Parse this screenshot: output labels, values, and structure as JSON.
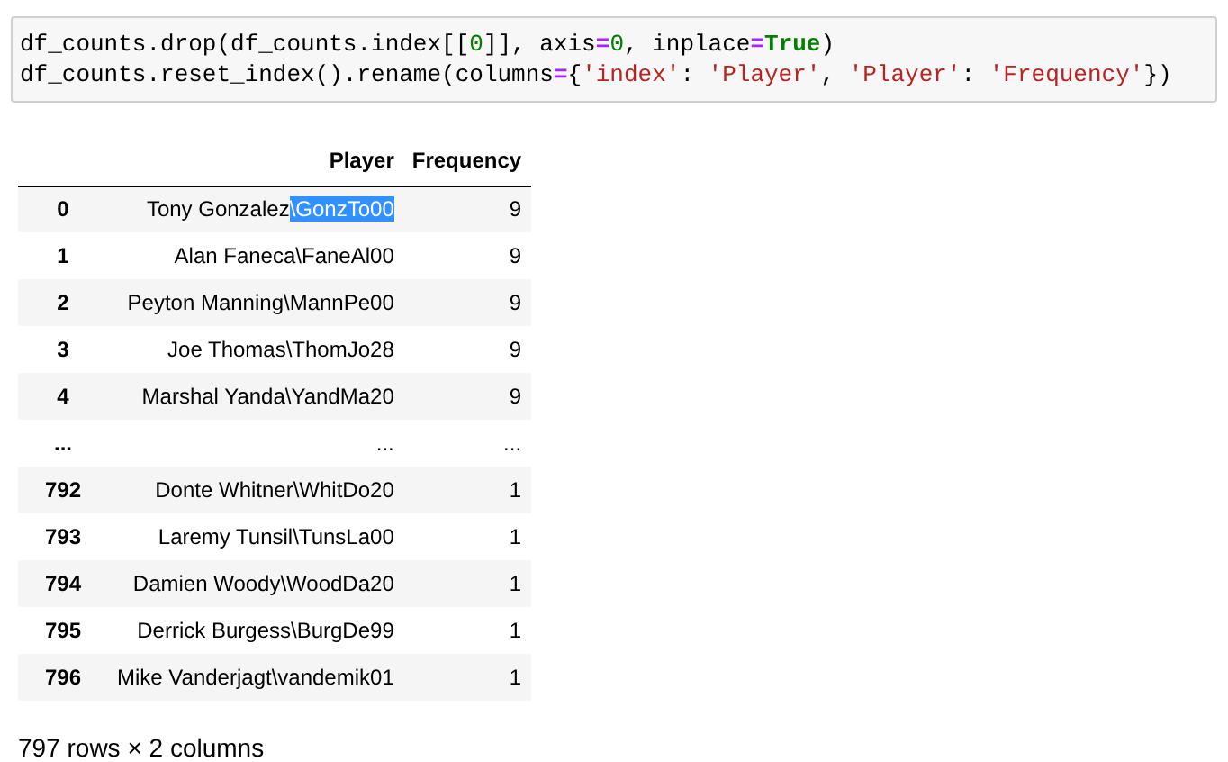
{
  "code_cell": {
    "lines": [
      {
        "tokens": [
          {
            "text": "df_counts.drop(df_counts.index[[",
            "kind": "plain"
          },
          {
            "text": "0",
            "kind": "number"
          },
          {
            "text": "]], axis",
            "kind": "plain"
          },
          {
            "text": "=",
            "kind": "operator"
          },
          {
            "text": "0",
            "kind": "number"
          },
          {
            "text": ", inplace",
            "kind": "plain"
          },
          {
            "text": "=",
            "kind": "operator"
          },
          {
            "text": "True",
            "kind": "keyword"
          },
          {
            "text": ")",
            "kind": "plain"
          }
        ]
      },
      {
        "tokens": [
          {
            "text": "df_counts.reset_index().rename(columns",
            "kind": "plain"
          },
          {
            "text": "=",
            "kind": "operator"
          },
          {
            "text": "{",
            "kind": "plain"
          },
          {
            "text": "'index'",
            "kind": "string"
          },
          {
            "text": ": ",
            "kind": "plain"
          },
          {
            "text": "'Player'",
            "kind": "string"
          },
          {
            "text": ", ",
            "kind": "plain"
          },
          {
            "text": "'Player'",
            "kind": "string"
          },
          {
            "text": ": ",
            "kind": "plain"
          },
          {
            "text": "'Frequency'",
            "kind": "string"
          },
          {
            "text": "})",
            "kind": "plain"
          }
        ]
      }
    ]
  },
  "table": {
    "columns": [
      "Player",
      "Frequency"
    ],
    "rows": [
      {
        "index": "0",
        "player_parts": [
          {
            "text": "Tony Gonzalez",
            "selected": false
          },
          {
            "text": "\\GonzTo00",
            "selected": true
          }
        ],
        "frequency": "9"
      },
      {
        "index": "1",
        "player_parts": [
          {
            "text": "Alan Faneca\\FaneAl00",
            "selected": false
          }
        ],
        "frequency": "9"
      },
      {
        "index": "2",
        "player_parts": [
          {
            "text": "Peyton Manning\\MannPe00",
            "selected": false
          }
        ],
        "frequency": "9"
      },
      {
        "index": "3",
        "player_parts": [
          {
            "text": "Joe Thomas\\ThomJo28",
            "selected": false
          }
        ],
        "frequency": "9"
      },
      {
        "index": "4",
        "player_parts": [
          {
            "text": "Marshal Yanda\\YandMa20",
            "selected": false
          }
        ],
        "frequency": "9"
      },
      {
        "index": "...",
        "player_parts": [
          {
            "text": "...",
            "selected": false
          }
        ],
        "frequency": "..."
      },
      {
        "index": "792",
        "player_parts": [
          {
            "text": "Donte Whitner\\WhitDo20",
            "selected": false
          }
        ],
        "frequency": "1"
      },
      {
        "index": "793",
        "player_parts": [
          {
            "text": "Laremy Tunsil\\TunsLa00",
            "selected": false
          }
        ],
        "frequency": "1"
      },
      {
        "index": "794",
        "player_parts": [
          {
            "text": "Damien Woody\\WoodDa20",
            "selected": false
          }
        ],
        "frequency": "1"
      },
      {
        "index": "795",
        "player_parts": [
          {
            "text": "Derrick Burgess\\BurgDe99",
            "selected": false
          }
        ],
        "frequency": "1"
      },
      {
        "index": "796",
        "player_parts": [
          {
            "text": "Mike Vanderjagt\\vandemik01",
            "selected": false
          }
        ],
        "frequency": "1"
      }
    ]
  },
  "shape_note": "797 rows × 2 columns"
}
